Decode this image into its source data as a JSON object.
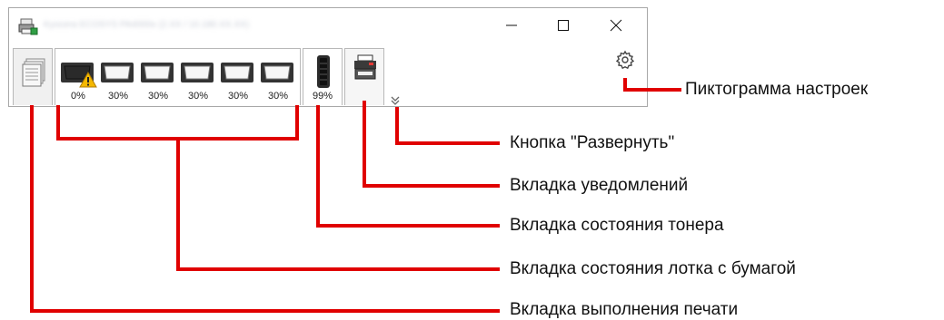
{
  "window": {
    "title": "Kyocera ECOSYS PA4000x (2.XX / 10.180.XX.XX)",
    "controls": {
      "minimize": "–",
      "maximize": "☐",
      "close": "✕"
    }
  },
  "tabs": {
    "paper_levels": [
      "0%",
      "30%",
      "30%",
      "30%",
      "30%",
      "30%"
    ],
    "toner_level": "99%"
  },
  "callouts": {
    "settings_icon": "Пиктограмма настроек",
    "expand_button": "Кнопка \"Развернуть\"",
    "notifications_tab": "Вкладка уведомлений",
    "toner_tab": "Вкладка состояния тонера",
    "paper_tray_tab": "Вкладка состояния лотка с бумагой",
    "print_progress_tab": "Вкладка выполнения печати"
  },
  "colors": {
    "callout_line": "#e00000",
    "warning": "#f5b800",
    "tray_dark": "#3a3a3a",
    "tab_border": "#b8b8b8"
  },
  "icons": [
    "app-printer-icon",
    "print-jobs-icon",
    "paper-tray-icon",
    "warning-icon",
    "toner-cartridge-icon",
    "mfp-printer-icon",
    "expand-chevron-icon",
    "gear-icon"
  ]
}
